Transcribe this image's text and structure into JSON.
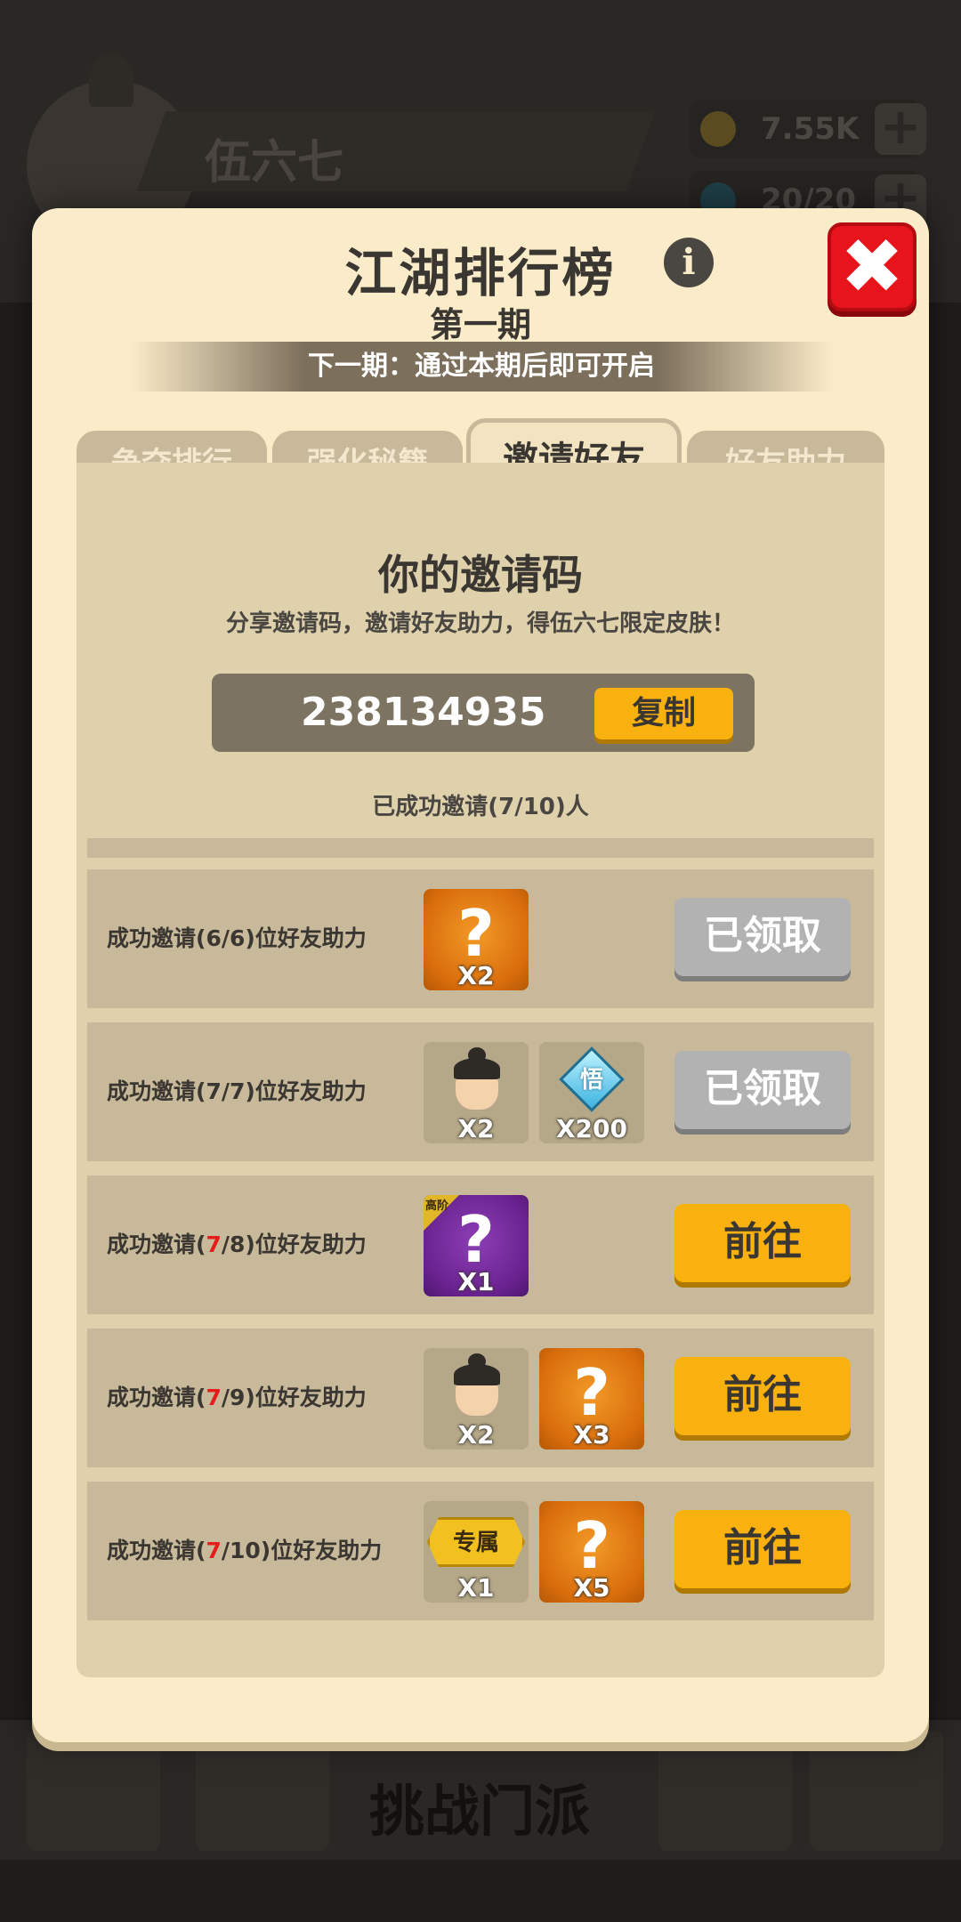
{
  "background": {
    "player_name": "伍六七",
    "gold": "7.55K",
    "gems": "20/20",
    "bottom_title": "挑战门派",
    "plus": "+"
  },
  "modal": {
    "title": "江湖排行榜",
    "info_icon": "i",
    "subtitle": "第一期",
    "period_text": "下一期：通过本期后即可开启",
    "close_icon": "✖"
  },
  "tabs": [
    {
      "label": "争夺排行"
    },
    {
      "label": "强化秘籍"
    },
    {
      "label": "邀请好友"
    },
    {
      "label": "好友助力"
    }
  ],
  "invite": {
    "title": "你的邀请码",
    "desc": "分享邀请码，邀请好友助力，得伍六七限定皮肤！",
    "code": "238134935",
    "copy_label": "复制",
    "count_text": "已成功邀请(7/10)人"
  },
  "rows": [
    {
      "label_prefix": "成功邀请(",
      "current": "6",
      "label_suffix": "/6)位好友助力",
      "reward1_icon": "?",
      "reward1_qty": "X2",
      "button": "已领取"
    },
    {
      "label_prefix": "成功邀请(",
      "current": "7",
      "label_suffix": "/7)位好友助力",
      "reward1_qty": "X2",
      "reward2_text": "悟",
      "reward2_qty": "X200",
      "button": "已领取"
    },
    {
      "label_prefix": "成功邀请(",
      "current": "7",
      "label_suffix": "/8)位好友助力",
      "reward1_corner": "高阶",
      "reward1_icon": "?",
      "reward1_qty": "X1",
      "button": "前往"
    },
    {
      "label_prefix": "成功邀请(",
      "current": "7",
      "label_suffix": "/9)位好友助力",
      "reward1_qty": "X2",
      "reward2_icon": "?",
      "reward2_qty": "X3",
      "button": "前往"
    },
    {
      "label_prefix": "成功邀请(",
      "current": "7",
      "label_suffix": "/10)位好友助力",
      "reward1_text": "专属",
      "reward1_qty": "X1",
      "reward2_icon": "?",
      "reward2_qty": "X5",
      "button": "前往"
    }
  ],
  "colors": {
    "modal_bg": "#fbecc9",
    "panel_bg": "#dfd1ac",
    "row_bg": "#c7b999",
    "accent_orange": "#f9b10f",
    "close_red": "#e8141c",
    "highlight_red": "#e51d1d",
    "claimed_gray": "#b2b2b2"
  }
}
